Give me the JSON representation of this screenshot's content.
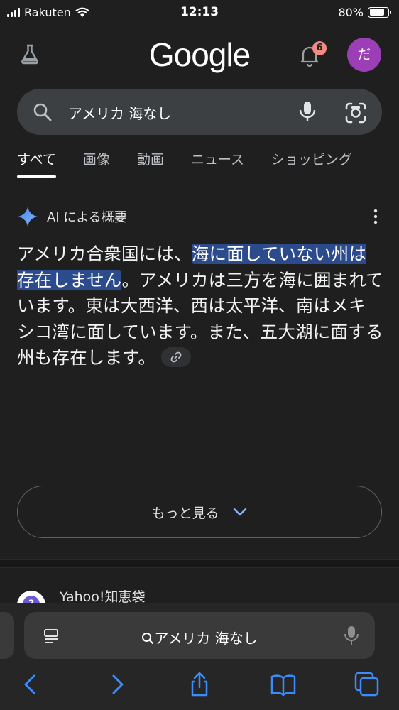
{
  "status": {
    "carrier": "Rakuten",
    "time": "12:13",
    "battery": "80%",
    "battery_level": 0.8
  },
  "header": {
    "logo": "Google",
    "notification_count": "6",
    "avatar_initial": "だ"
  },
  "search": {
    "query": "アメリカ 海なし"
  },
  "tabs": [
    "すべて",
    "画像",
    "動画",
    "ニュース",
    "ショッピング"
  ],
  "ai_overview": {
    "title": "AI による概要",
    "text_highlight": "海に面していない州は存在しません",
    "text_before": "アメリカ合衆国には、",
    "text_after": "。アメリカは三方を海に囲まれています。東は大西洋、西は太平洋、南はメキシコ湾に面しています。また、五大湖に面する州も存在します。",
    "more_label": "もっと見る"
  },
  "result": {
    "title": "Yahoo!知恵袋"
  },
  "browser": {
    "address_text": "アメリカ 海なし"
  },
  "colors": {
    "background": "#1f1f1f",
    "search_box": "#3c4043",
    "highlight": "#2b4b8d",
    "avatar": "#9c3fb7",
    "badge": "#f28b82",
    "safari_blue": "#3b8cff"
  }
}
